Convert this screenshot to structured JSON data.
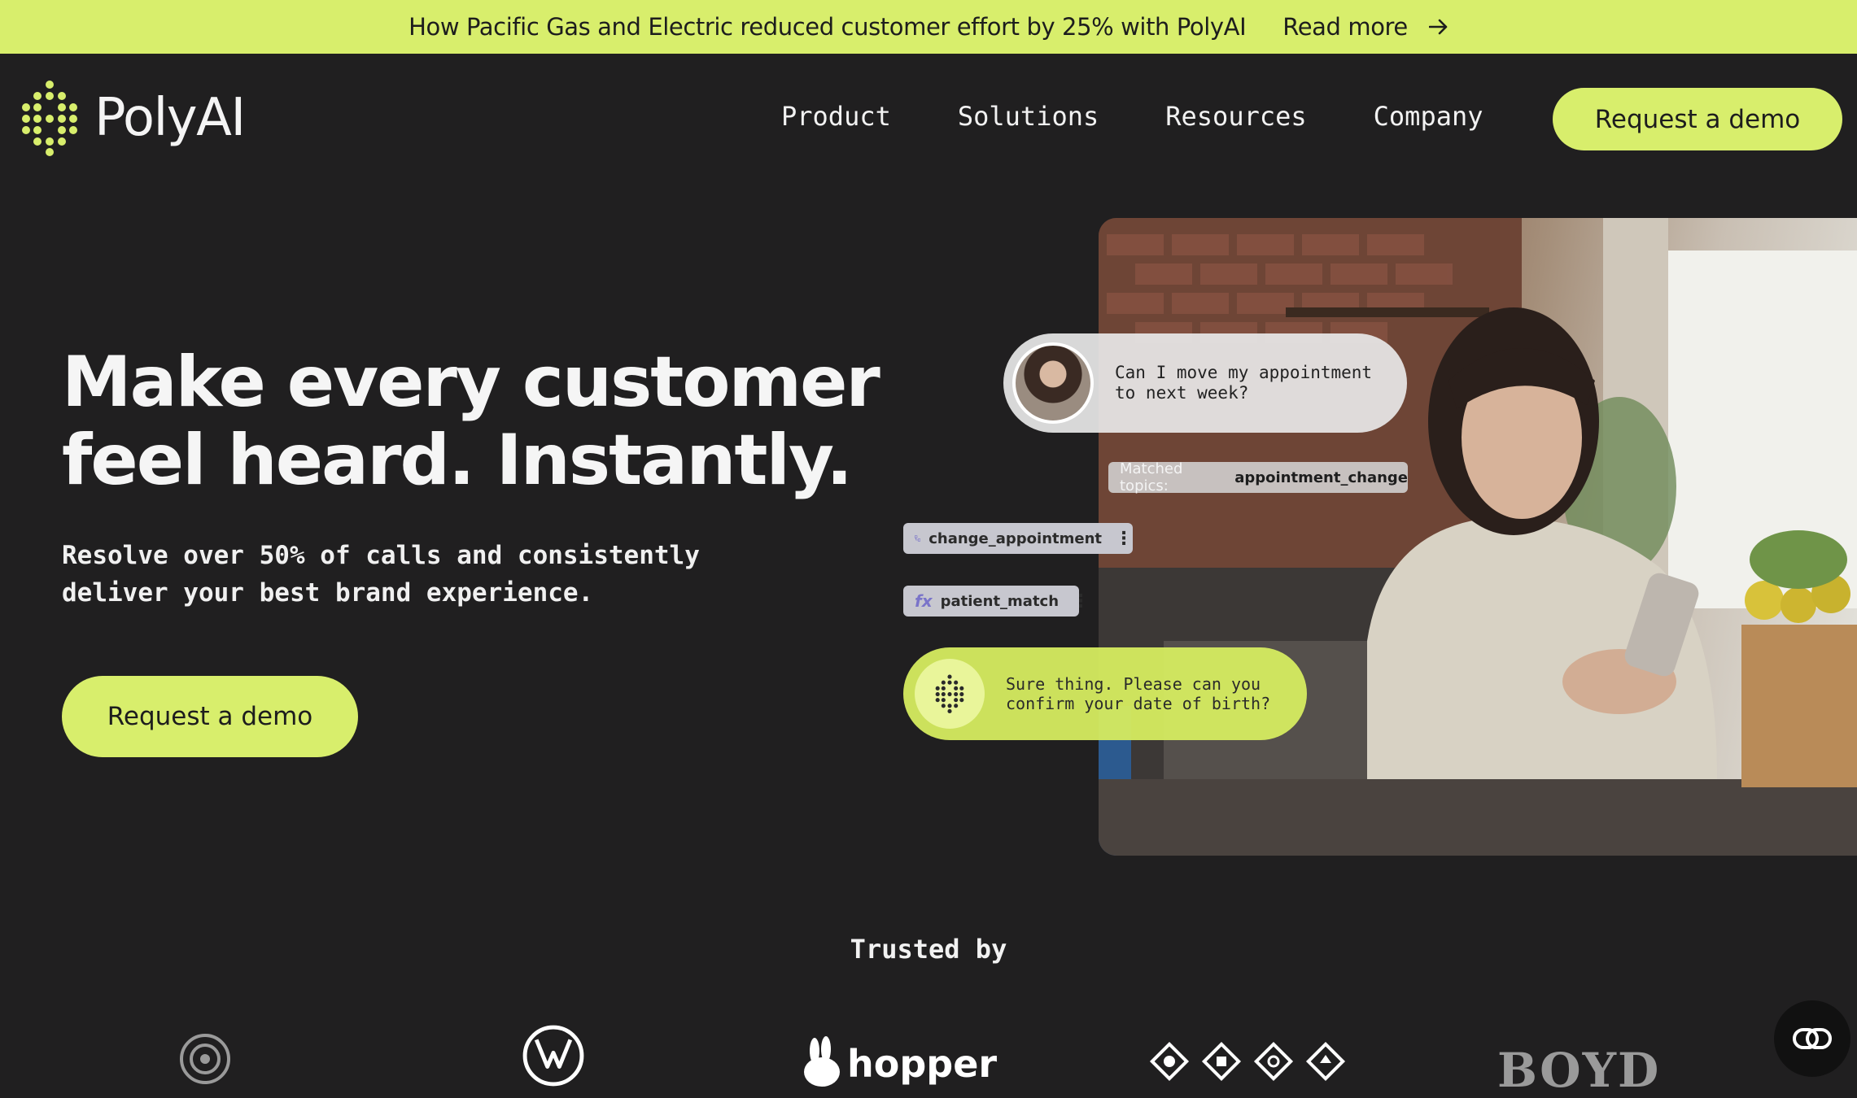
{
  "banner": {
    "text": "How Pacific Gas and Electric reduced customer effort by 25% with PolyAI",
    "link_label": "Read more",
    "arrow_icon": "arrow-right-icon"
  },
  "nav": {
    "logo_text": "PolyAI",
    "links": [
      "Product",
      "Solutions",
      "Resources",
      "Company"
    ],
    "cta_label": "Request a demo"
  },
  "hero": {
    "title_lines": [
      "Make every customer",
      "feel heard. Instantly."
    ],
    "subtitle_lines": [
      "Resolve over 50% of calls and consistently",
      "deliver your best brand experience."
    ],
    "cta_label": "Request a demo"
  },
  "demo": {
    "user_message_lines": [
      "Can I move my appointment",
      "to next week?"
    ],
    "matched_label": "Matched topics:",
    "matched_value": "appointment_change",
    "function_1": "change_appointment",
    "function_2": "patient_match",
    "bot_message_lines": [
      "Sure thing. Please can you",
      "confirm your date of birth?"
    ]
  },
  "trusted": {
    "heading": "Trusted by",
    "logo_names": [
      "circle-emblem-logo",
      "volkswagen-logo",
      "hopper-logo",
      "diamond-icons-logo",
      "boyd-logo"
    ],
    "hopper_text": "hopper",
    "boyd_text": "BOYD"
  },
  "colors": {
    "background": "#201f20",
    "accent": "#d8ee6c",
    "text": "#f4f4f4"
  }
}
